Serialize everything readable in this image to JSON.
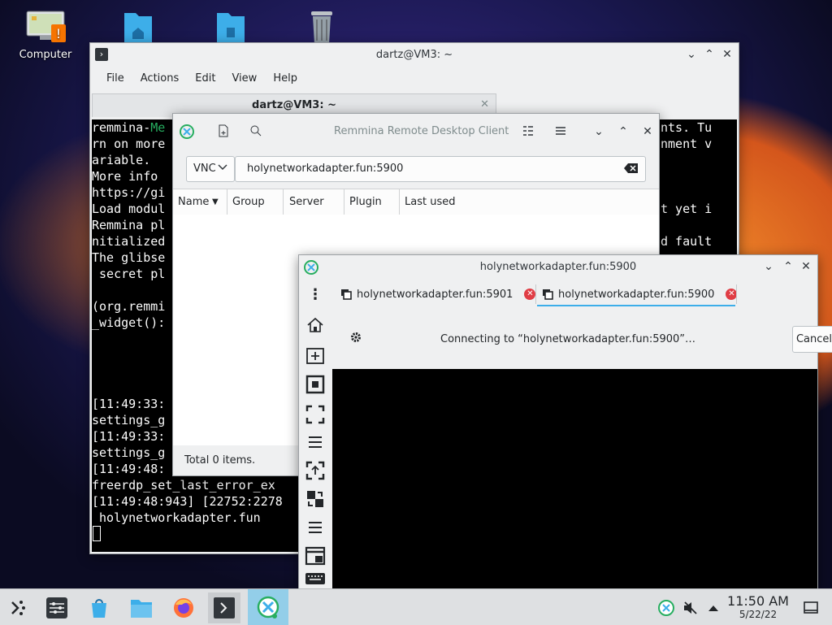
{
  "desktop": {
    "icons": [
      {
        "label": "Computer"
      },
      {
        "label": ""
      },
      {
        "label": ""
      },
      {
        "label": ""
      }
    ]
  },
  "konsole": {
    "title": "dartz@VM3: ~",
    "tab_title": "dartz@VM3: ~",
    "menu": [
      "File",
      "Actions",
      "Edit",
      "View",
      "Help"
    ],
    "lines_left": [
      "remmina-",
      "rn on more",
      "ariable.",
      "More info ",
      "https://gi",
      "Load modul",
      "Remmina pl",
      "nitialized",
      "The glibse",
      " secret pl",
      "",
      "(org.remmi",
      "_widget():",
      "",
      "",
      "",
      "",
      "[11:49:33:",
      "settings_g",
      "[11:49:33:",
      "settings_g",
      "[11:49:48:",
      "freerdp_set_last_error_ex",
      "[11:49:48:943] [22752:2278",
      " holynetworkadapter.fun"
    ],
    "green_fragment": "Me",
    "lines_right": [
      "nts. Tu",
      "nment v",
      "",
      "",
      "",
      "t yet i",
      "",
      "d fault",
      ""
    ]
  },
  "remmina": {
    "title": "Remmina Remote Desktop Client",
    "protocol": "VNC",
    "address": "holynetworkadapter.fun:5900",
    "columns": [
      "Name",
      "Group",
      "Server",
      "Plugin",
      "Last used"
    ],
    "status": "Total 0 items."
  },
  "connection": {
    "title": "holynetworkadapter.fun:5900",
    "tabs": [
      {
        "label": "holynetworkadapter.fun:5901"
      },
      {
        "label": "holynetworkadapter.fun:5900"
      }
    ],
    "message": "Connecting to “holynetworkadapter.fun:5900”…",
    "cancel": "Cancel"
  },
  "taskbar": {
    "time": "11:50 AM",
    "date": "5/22/22"
  },
  "colors": {
    "accent": "#3daee9",
    "term_green": "#27ae60",
    "close_red": "#e03d45"
  }
}
